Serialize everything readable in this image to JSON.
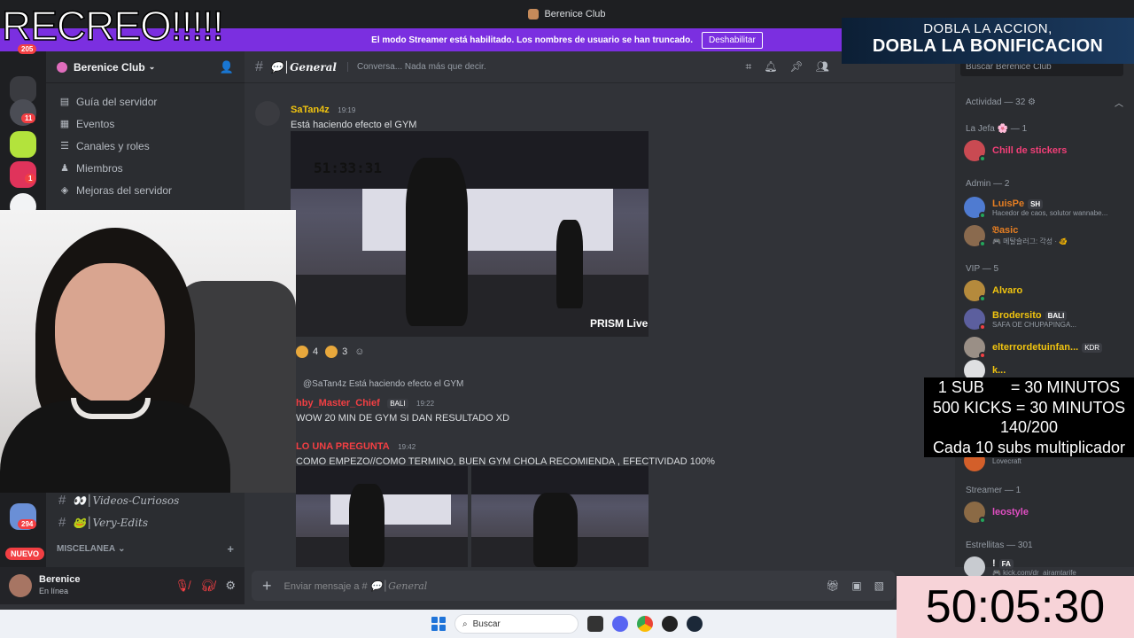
{
  "window": {
    "title": "Berenice Club"
  },
  "banner": {
    "text": "El modo Streamer está habilitado. Los nombres de usuario se han truncado.",
    "button": "Deshabilitar"
  },
  "rail": {
    "badges": [
      "205",
      "11",
      "1",
      "294"
    ],
    "new_label": "NUEVO"
  },
  "server": {
    "name": "Berenice Club"
  },
  "nav": [
    {
      "icon": "book-icon",
      "label": "Guía del servidor"
    },
    {
      "icon": "calendar-icon",
      "label": "Eventos"
    },
    {
      "icon": "list-icon",
      "label": "Canales y roles"
    },
    {
      "icon": "people-icon",
      "label": "Miembros"
    },
    {
      "icon": "boost-icon",
      "label": "Mejoras del servidor"
    }
  ],
  "channels": [
    {
      "label": "👀│Videos-Curiosos"
    },
    {
      "label": "🐸│Very-Edits"
    }
  ],
  "category": {
    "label": "MISCELANEA"
  },
  "user": {
    "name": "Berenice",
    "status": "En línea"
  },
  "chat": {
    "channel": "💬│General",
    "topic": "Conversa... Nada más que decir.",
    "messages": [
      {
        "author": "SaTan4z",
        "time": "19:19",
        "text": "Está haciendo efecto el GYM",
        "video_timer": "51:33:31",
        "video_watermark": "PRISM Live"
      },
      {
        "reactions": [
          "4",
          "3"
        ]
      },
      {
        "reply": "@SaTan4z Está haciendo efecto el GYM",
        "author": "hby_Master_Chief",
        "tag": "BALI",
        "time": "19:22",
        "text": "WOW 20 MIN DE GYM SI DAN RESULTADO XD"
      },
      {
        "author": "LO UNA PREGUNTA",
        "time": "19:42",
        "text": "COMO EMPEZO//COMO TERMINO, BUEN GYM CHOLA RECOMIENDA , EFECTIVIDAD 100%"
      }
    ],
    "composer_placeholder_prefix": "Enviar mensaje a #",
    "composer_placeholder_channel": "💬│General"
  },
  "members": {
    "search_placeholder": "Buscar Berenice Club",
    "activity_label": "Actividad — 32",
    "sections": [
      {
        "label": "La Jefa 🌸 — 1"
      },
      {
        "label": "Admin — 2"
      },
      {
        "label": "VIP — 5"
      },
      {
        "label": "Streamer — 1"
      },
      {
        "label": "Estrellitas — 301"
      }
    ],
    "rows": [
      {
        "name": "Chill de stickers",
        "color": "#f23f78",
        "sub": ""
      },
      {
        "name": "LuisPe",
        "color": "#e67e22",
        "tag": "SH",
        "sub": "Hacedor de caos, solutor wannabe..."
      },
      {
        "name": "𝔅asic",
        "color": "#e67e22",
        "sub": "🎮 메탈슬러그: 각성 · 🐠"
      },
      {
        "name": "Alvaro",
        "color": "#f1c40f",
        "sub": ""
      },
      {
        "name": "Brodersito",
        "color": "#f1c40f",
        "tag": "BALI",
        "sub": "SAFA OE CHUPAPINGA..."
      },
      {
        "name": "elterrordetuinfan...",
        "color": "#f1c40f",
        "tag": "KDR",
        "sub": ""
      },
      {
        "name": "k...",
        "color": "#f1c40f",
        "sub": ""
      },
      {
        "name": "",
        "color": "#f1c40f",
        "sub": "Lovecraft"
      },
      {
        "name": "leostyle",
        "color": "#e04ec2",
        "sub": ""
      },
      {
        "name": "!",
        "color": "#f2f3f5",
        "tag": "FA",
        "sub": "🎮 kick.com/dr_airamtarife"
      }
    ]
  },
  "taskbar": {
    "search_label": "Buscar"
  },
  "overlays": {
    "recreo": "RECREO!!!!!",
    "promo_line1": "DOBLA LA ACCION,",
    "promo_line2": "DOBLA LA BONIFICACION",
    "subgoal": [
      "1 SUB      = 30 MINUTOS",
      "500 KICKS = 30 MINUTOS",
      "140/200",
      "Cada 10 subs multiplicador"
    ],
    "countdown": "50:05:30"
  }
}
